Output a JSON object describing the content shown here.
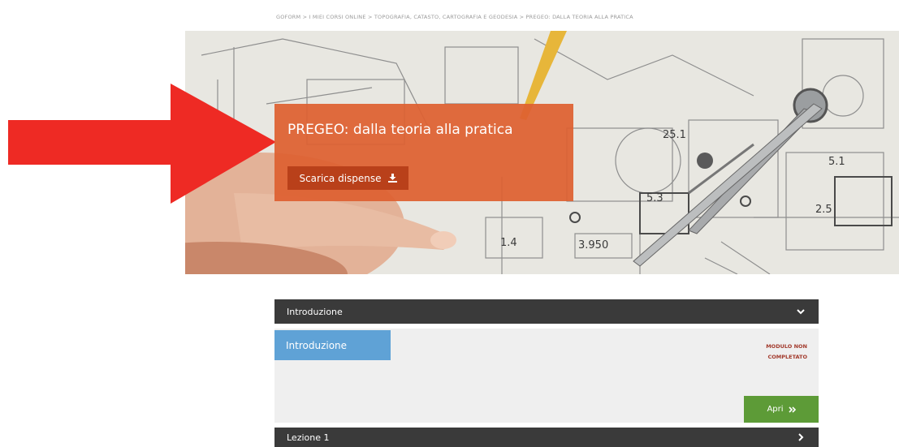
{
  "breadcrumb": "GOFORM > I MIEI CORSI ONLINE > TOPOGRAFIA, CATASTO, CARTOGRAFIA E GEODESIA > PREGEO: DALLA TEORIA ALLA PRATICA",
  "course": {
    "title": "PREGEO: dalla teoria alla pratica",
    "download_label": "Scarica dispense"
  },
  "hero_drawing_labels": [
    "25.1",
    "5.3",
    "2.5",
    "1.4",
    "3.950",
    "5.1"
  ],
  "sections": [
    {
      "title": "Introduzione",
      "expanded": true,
      "chevron": "chevron-down-icon"
    },
    {
      "title": "Lezione 1",
      "expanded": false,
      "chevron": "chevron-right-icon"
    }
  ],
  "module": {
    "tab_label": "Introduzione",
    "status": "MODULO NON COMPLETATO",
    "open_label": "Apri"
  },
  "colors": {
    "title_box": "#de6030",
    "download_button": "#b9401a",
    "accordion_header": "#3a3a3a",
    "module_tab": "#5fa2d6",
    "open_button": "#5d9b37",
    "status_text": "#a23a2c",
    "arrow": "#ee2a24"
  }
}
